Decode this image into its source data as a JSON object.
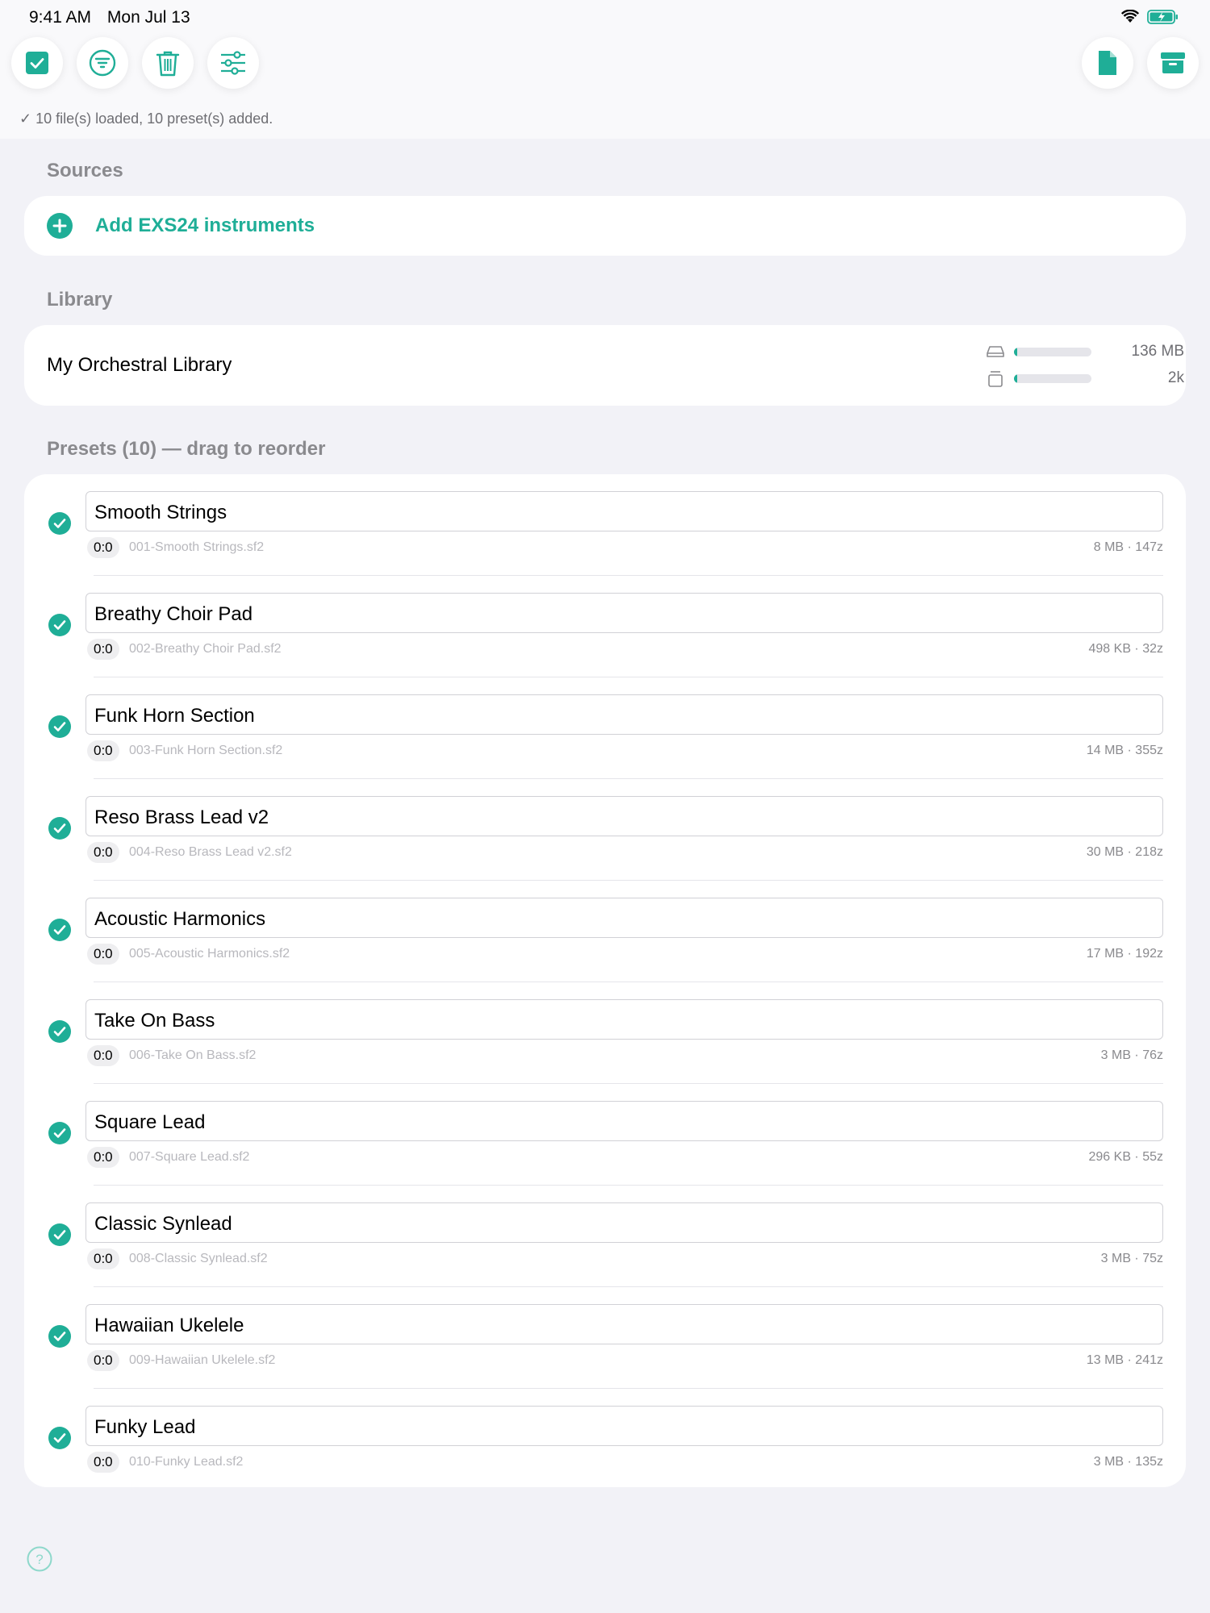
{
  "status_bar": {
    "time": "9:41 AM",
    "date": "Mon Jul 13"
  },
  "toolbar": {
    "left": [
      "checkbox-icon",
      "filter-icon",
      "trash-icon",
      "sliders-icon"
    ],
    "right": [
      "document-icon",
      "archive-icon"
    ]
  },
  "load_message": "✓ 10 file(s) loaded, 10 preset(s) added.",
  "sources": {
    "header": "Sources",
    "add_label": "Add EXS24 instruments"
  },
  "library": {
    "header": "Library",
    "name": "My Orchestral Library",
    "disk_value": "136 MB",
    "disk_fill": 0.04,
    "count_value": "2k",
    "count_fill": 0.04
  },
  "presets_header": "Presets (10) — drag to reorder",
  "presets": [
    {
      "name": "Smooth Strings",
      "bank": "0:0",
      "file": "001-Smooth Strings.sf2",
      "size": "8 MB · 147z"
    },
    {
      "name": "Breathy Choir Pad",
      "bank": "0:0",
      "file": "002-Breathy Choir Pad.sf2",
      "size": "498 KB · 32z"
    },
    {
      "name": "Funk Horn Section",
      "bank": "0:0",
      "file": "003-Funk Horn Section.sf2",
      "size": "14 MB · 355z"
    },
    {
      "name": "Reso Brass Lead v2",
      "bank": "0:0",
      "file": "004-Reso Brass Lead v2.sf2",
      "size": "30 MB · 218z"
    },
    {
      "name": "Acoustic Harmonics",
      "bank": "0:0",
      "file": "005-Acoustic Harmonics.sf2",
      "size": "17 MB · 192z"
    },
    {
      "name": "Take On Bass",
      "bank": "0:0",
      "file": "006-Take On Bass.sf2",
      "size": "3 MB · 76z"
    },
    {
      "name": "Square Lead",
      "bank": "0:0",
      "file": "007-Square Lead.sf2",
      "size": "296 KB · 55z"
    },
    {
      "name": "Classic Synlead",
      "bank": "0:0",
      "file": "008-Classic Synlead.sf2",
      "size": "3 MB · 75z"
    },
    {
      "name": "Hawaiian Ukelele",
      "bank": "0:0",
      "file": "009-Hawaiian Ukelele.sf2",
      "size": "13 MB · 241z"
    },
    {
      "name": "Funky Lead",
      "bank": "0:0",
      "file": "010-Funky Lead.sf2",
      "size": "3 MB · 135z"
    }
  ],
  "colors": {
    "accent": "#1fae97",
    "background": "#f2f2f7"
  }
}
